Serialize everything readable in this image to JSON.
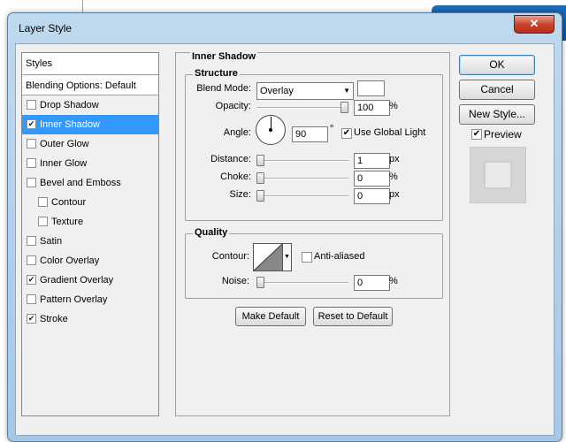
{
  "window": {
    "title": "Layer Style",
    "close_glyph": "✕"
  },
  "styles_list": {
    "header": "Styles",
    "blending_options": "Blending Options: Default",
    "items": [
      {
        "label": "Drop Shadow",
        "checked": false,
        "selected": false,
        "indent": false
      },
      {
        "label": "Inner Shadow",
        "checked": true,
        "selected": true,
        "indent": false
      },
      {
        "label": "Outer Glow",
        "checked": false,
        "selected": false,
        "indent": false
      },
      {
        "label": "Inner Glow",
        "checked": false,
        "selected": false,
        "indent": false
      },
      {
        "label": "Bevel and Emboss",
        "checked": false,
        "selected": false,
        "indent": false
      },
      {
        "label": "Contour",
        "checked": false,
        "selected": false,
        "indent": true
      },
      {
        "label": "Texture",
        "checked": false,
        "selected": false,
        "indent": true
      },
      {
        "label": "Satin",
        "checked": false,
        "selected": false,
        "indent": false
      },
      {
        "label": "Color Overlay",
        "checked": false,
        "selected": false,
        "indent": false
      },
      {
        "label": "Gradient Overlay",
        "checked": true,
        "selected": false,
        "indent": false
      },
      {
        "label": "Pattern Overlay",
        "checked": false,
        "selected": false,
        "indent": false
      },
      {
        "label": "Stroke",
        "checked": true,
        "selected": false,
        "indent": false
      }
    ]
  },
  "inner_shadow": {
    "title": "Inner Shadow",
    "structure": {
      "legend": "Structure",
      "blend_mode_label": "Blend Mode:",
      "blend_mode_value": "Overlay",
      "shadow_color": "#ffffff",
      "opacity_label": "Opacity:",
      "opacity_value": "100",
      "opacity_unit": "%",
      "opacity_level": 1.0,
      "angle_label": "Angle:",
      "angle_value": "90",
      "angle_unit": "°",
      "use_global_light_label": "Use Global Light",
      "use_global_light_checked": true,
      "distance_label": "Distance:",
      "distance_value": "1",
      "distance_unit": "px",
      "choke_label": "Choke:",
      "choke_value": "0",
      "choke_unit": "%",
      "size_label": "Size:",
      "size_value": "0",
      "size_unit": "px"
    },
    "quality": {
      "legend": "Quality",
      "contour_label": "Contour:",
      "anti_aliased_label": "Anti-aliased",
      "anti_aliased_checked": false,
      "noise_label": "Noise:",
      "noise_value": "0",
      "noise_unit": "%"
    },
    "make_default_label": "Make Default",
    "reset_default_label": "Reset to Default"
  },
  "buttons": {
    "ok": "OK",
    "cancel": "Cancel",
    "new_style": "New Style..."
  },
  "preview": {
    "label": "Preview",
    "checked": true
  },
  "colors": {
    "selection": "#3399ff",
    "title_bar": "#bfd9ee",
    "close_button": "#c8452f"
  }
}
